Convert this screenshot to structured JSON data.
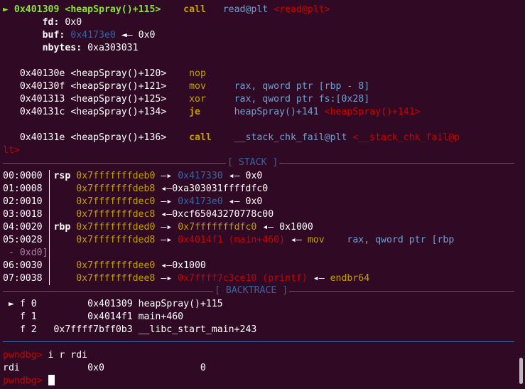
{
  "disasm": {
    "current": {
      "marker": "►",
      "addr": "0x401309",
      "sym": "<heapSpray()+115>",
      "mnem": "call",
      "op": "read@plt",
      "target": "<read@plt>"
    },
    "args": [
      {
        "name": "fd:",
        "val": "0x0"
      },
      {
        "name": "buf:",
        "ptr": "0x4173e0",
        "arrow": "◄—",
        "val": "0x0"
      },
      {
        "name": "nbytes:",
        "val": "0xa303031"
      }
    ],
    "rows": [
      {
        "addr": "0x40130e",
        "sym": "<heapSpray()+120>",
        "mnem": "nop",
        "op": ""
      },
      {
        "addr": "0x40130f",
        "sym": "<heapSpray()+121>",
        "mnem": "mov",
        "op": "rax, qword ptr [rbp - 8]"
      },
      {
        "addr": "0x401313",
        "sym": "<heapSpray()+125>",
        "mnem": "xor",
        "op": "rax, qword ptr fs:[0x28]"
      },
      {
        "addr": "0x40131c",
        "sym": "<heapSpray()+134>",
        "mnem": "je",
        "op": "heapSpray()+141",
        "target": "<heapSpray()+141>"
      },
      {
        "addr": "0x40131e",
        "sym": "<heapSpray()+136>",
        "mnem": "call",
        "op": "__stack_chk_fail@plt",
        "target": "<__stack_chk_fail@p",
        "wrap": "lt>"
      }
    ]
  },
  "stack": {
    "title": "[ STACK ]",
    "rows": [
      {
        "off": "00:0000",
        "reg": "rsp",
        "addr": "0x7fffffffdeb0",
        "a1": "—▸",
        "v1": "0x417330",
        "a2": "◂—",
        "v2": "0x0"
      },
      {
        "off": "01:0008",
        "reg": "",
        "addr": "0x7fffffffdeb8",
        "a1": "◂—",
        "v1": "0xa303031ffffdfc0"
      },
      {
        "off": "02:0010",
        "reg": "",
        "addr": "0x7fffffffdec0",
        "a1": "—▸",
        "v1": "0x4173e0",
        "a2": "◂—",
        "v2": "0x0"
      },
      {
        "off": "03:0018",
        "reg": "",
        "addr": "0x7fffffffdec8",
        "a1": "◂—",
        "v1": "0xcf65043270778c00"
      },
      {
        "off": "04:0020",
        "reg": "rbp",
        "addr": "0x7fffffffded0",
        "a1": "—▸",
        "v1": "0x7fffffffdfc0",
        "a2": "◂—",
        "v2": "0x1000"
      },
      {
        "off": "05:0028",
        "reg": "",
        "addr": "0x7fffffffded8",
        "a1": "—▸",
        "v1": "0x4014f1 (main+460)",
        "a2": "◂—",
        "v2": "mov",
        "v3": "rax, qword ptr [rbp",
        "wrap": " - 0xd0]"
      },
      {
        "off": "06:0030",
        "reg": "",
        "addr": "0x7fffffffdee0",
        "a1": "◂—",
        "v1": "0x1000"
      },
      {
        "off": "07:0038",
        "reg": "",
        "addr": "0x7fffffffdee8",
        "a1": "—▸",
        "v1": "0x7ffff7c3ce10 (printf)",
        "a2": "◂—",
        "v2": "endbr64"
      }
    ]
  },
  "backtrace": {
    "title": "[ BACKTRACE ]",
    "frames": [
      {
        "marker": "►",
        "frame": "f 0",
        "addr": "0x401309",
        "fn": "heapSpray()+115"
      },
      {
        "marker": "",
        "frame": "f 1",
        "addr": "0x4014f1",
        "fn": "main+460"
      },
      {
        "marker": "",
        "frame": "f 2",
        "addr": "0x7ffff7bff0b3",
        "fn": "__libc_start_main+243"
      }
    ]
  },
  "console": {
    "prompt": "pwndbg>",
    "command": "i r rdi",
    "reg": "rdi",
    "hex": "0x0",
    "dec": "0"
  }
}
